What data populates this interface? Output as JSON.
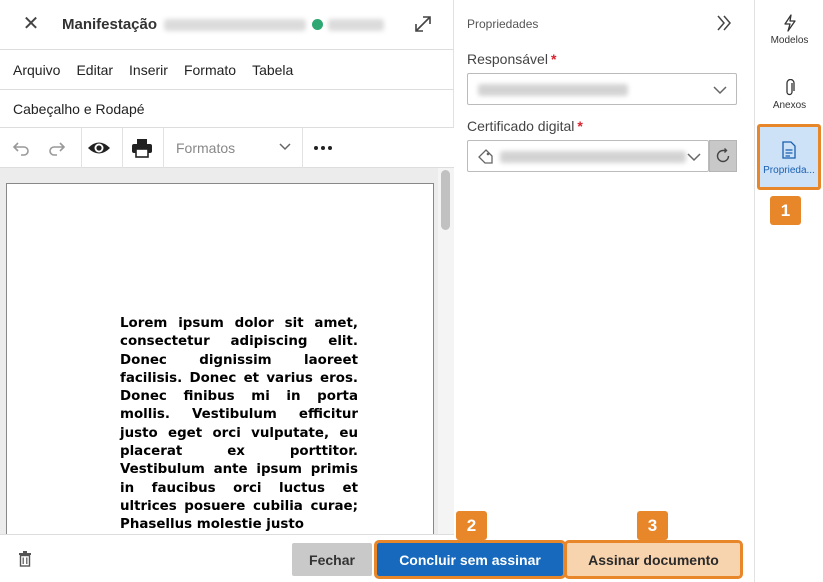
{
  "editor": {
    "title": "Manifestação",
    "menu": [
      "Arquivo",
      "Editar",
      "Inserir",
      "Formato",
      "Tabela"
    ],
    "menu2": "Cabeçalho e Rodapé",
    "formats_label": "Formatos",
    "document_text": "Lorem ipsum dolor sit amet, consectetur adipiscing elit. Donec dignissim laoreet facilisis. Donec et varius eros. Donec finibus mi in porta mollis. Vestibulum efficitur justo eget orci vulputate, eu placerat ex porttitor. Vestibulum ante ipsum primis in faucibus orci luctus et ultrices posuere cubilia curae; Phasellus molestie justo"
  },
  "properties": {
    "heading": "Propriedades",
    "responsavel_label": "Responsável",
    "certificado_label": "Certificado digital",
    "required_mark": "*"
  },
  "buttons": {
    "fechar": "Fechar",
    "concluir": "Concluir sem assinar",
    "assinar": "Assinar documento"
  },
  "rail": {
    "modelos": "Modelos",
    "anexos": "Anexos",
    "propriedades": "Proprieda..."
  },
  "badges": [
    "1",
    "2",
    "3"
  ],
  "colors": {
    "highlight": "#e8862a",
    "primary": "#1669bd",
    "status_ok": "#2ea872",
    "required": "#d9232e"
  }
}
